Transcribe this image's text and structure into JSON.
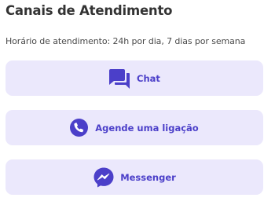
{
  "header": {
    "title": "Canais de Atendimento",
    "hours_text": "Horário de atendimento: 24h por dia, 7 dias por semana"
  },
  "channels": [
    {
      "label": "Chat",
      "icon": "chat-bubbles-icon"
    },
    {
      "label": "Agende uma ligação",
      "icon": "phone-icon"
    },
    {
      "label": "Messenger",
      "icon": "messenger-icon"
    }
  ],
  "colors": {
    "accent": "#4b3fc9",
    "button_background": "#ebe8fc",
    "title_text": "#333333",
    "body_text": "#4a4a4a"
  }
}
